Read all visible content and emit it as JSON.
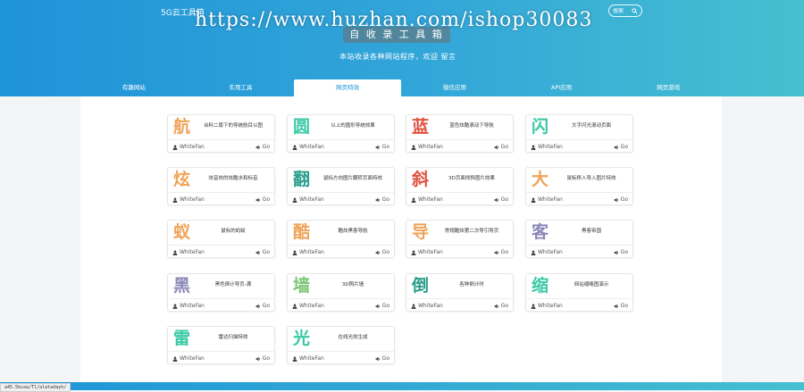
{
  "header": {
    "brand": "5G云工具箱",
    "search_placeholder": "搜索",
    "watermark": "https://www.huzhan.com/ishop30083",
    "site_title": "自 收 录 工 具 箱",
    "site_subtitle": "本站收录各种网站程序，欢迎 留言"
  },
  "nav": {
    "items": [
      {
        "label": "有趣网站",
        "active": false
      },
      {
        "label": "实用工具",
        "active": false
      },
      {
        "label": "网页特效",
        "active": true
      },
      {
        "label": "微信应用",
        "active": false
      },
      {
        "label": "API应用",
        "active": false
      },
      {
        "label": "网页游戏",
        "active": false
      }
    ]
  },
  "cards": [
    {
      "glyph": "航",
      "color": "#f0a35a",
      "desc": "台料二版下的导统航目以图",
      "author": "WhiteFan",
      "go": "Go"
    },
    {
      "glyph": "圆",
      "color": "#39c9a5",
      "desc": "以上的圆形导统效果",
      "author": "WhiteFan",
      "go": "Go"
    },
    {
      "glyph": "蓝",
      "color": "#e0503f",
      "desc": "蓝色炫酷滚动下导航",
      "author": "WhiteFan",
      "go": "Go"
    },
    {
      "glyph": "闪",
      "color": "#39c9a5",
      "desc": "文字闪光滚动页面",
      "author": "WhiteFan",
      "go": "Go"
    },
    {
      "glyph": "炫",
      "color": "#f0a35a",
      "desc": "炫音效的炫酷水和标音",
      "author": "WhiteFan",
      "go": "Go"
    },
    {
      "glyph": "翻",
      "color": "#2a9e8c",
      "desc": "鼠标方向图片翻转页面特效",
      "author": "WhiteFan",
      "go": "Go"
    },
    {
      "glyph": "斜",
      "color": "#e0503f",
      "desc": "3D页面倾斜图片效果",
      "author": "WhiteFan",
      "go": "Go"
    },
    {
      "glyph": "大",
      "color": "#f0a35a",
      "desc": "鼠标移入导入图片特效",
      "author": "WhiteFan",
      "go": "Go"
    },
    {
      "glyph": "蚁",
      "color": "#f0a35a",
      "desc": "鼠标的蚂蚁",
      "author": "WhiteFan",
      "go": "Go"
    },
    {
      "glyph": "酷",
      "color": "#f0a35a",
      "desc": "酷炫黑客导航",
      "author": "WhiteFan",
      "go": "Go"
    },
    {
      "glyph": "导",
      "color": "#f0a35a",
      "desc": "常规酷炫第二次导引导页",
      "author": "WhiteFan",
      "go": "Go"
    },
    {
      "glyph": "客",
      "color": "#8b87b8",
      "desc": "黑客帝国",
      "author": "WhiteFan",
      "go": "Go"
    },
    {
      "glyph": "黑",
      "color": "#8b87b8",
      "desc": "黑色倒计导页-满",
      "author": "WhiteFan",
      "go": "Go"
    },
    {
      "glyph": "墙",
      "color": "#7cc576",
      "desc": "3D照片墙",
      "author": "WhiteFan",
      "go": "Go"
    },
    {
      "glyph": "倒",
      "color": "#2a9e8c",
      "desc": "各种倒计时",
      "author": "WhiteFan",
      "go": "Go"
    },
    {
      "glyph": "缩",
      "color": "#39c9a5",
      "desc": "网站缩略图演示",
      "author": "WhiteFan",
      "go": "Go"
    },
    {
      "glyph": "雷",
      "color": "#39c9a5",
      "desc": "雷达扫描特效",
      "author": "WhiteFan",
      "go": "Go"
    },
    {
      "glyph": "光",
      "color": "#39c9a5",
      "desc": "在线光效生成",
      "author": "WhiteFan",
      "go": "Go"
    }
  ],
  "status": {
    "url": "a45.5kuxw/Tl/alatadayh/"
  },
  "colors": {
    "header_start": "#1e93d8",
    "header_end": "#46bfd0",
    "active_nav_text": "#1e93d8"
  },
  "icons": {
    "search": "search-icon",
    "author": "user-icon",
    "go": "volume-icon"
  }
}
